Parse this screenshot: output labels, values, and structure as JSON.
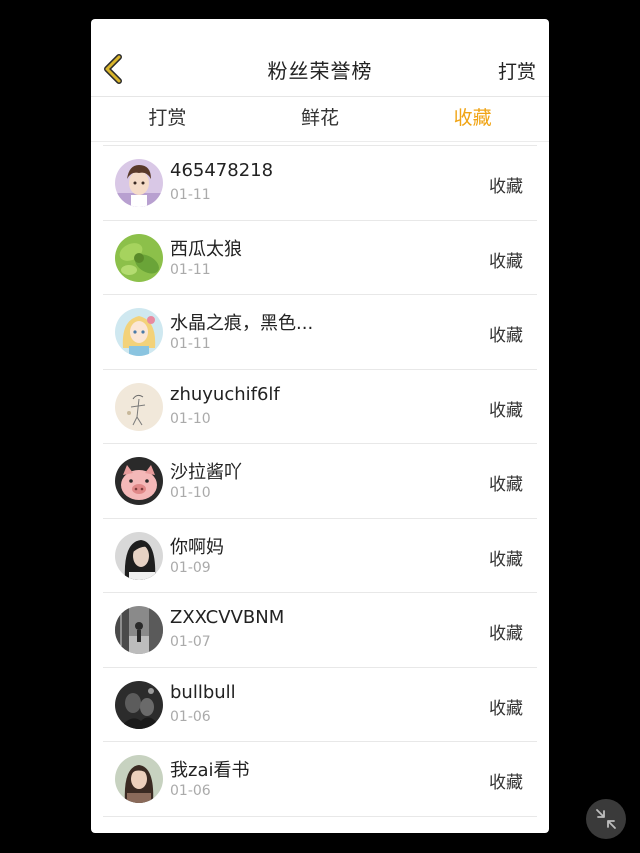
{
  "header": {
    "title": "粉丝荣誉榜",
    "reward_link": "打赏"
  },
  "tabs": [
    {
      "label": "打赏",
      "active": false
    },
    {
      "label": "鲜花",
      "active": false
    },
    {
      "label": "收藏",
      "active": true
    }
  ],
  "colors": {
    "accent": "#f0a415",
    "back_arrow": "#c8a020"
  },
  "list": [
    {
      "name": "465478218",
      "date": "01-11",
      "action": "收藏",
      "avatar": "anime-boy-avatar"
    },
    {
      "name": "西瓜太狼",
      "date": "01-11",
      "action": "收藏",
      "avatar": "green-leaf-avatar"
    },
    {
      "name": "水晶之痕，黑色...",
      "date": "01-11",
      "action": "收藏",
      "avatar": "anime-girl-avatar"
    },
    {
      "name": "zhuyuchif6lf",
      "date": "01-10",
      "action": "收藏",
      "avatar": "sketch-avatar"
    },
    {
      "name": "沙拉酱吖",
      "date": "01-10",
      "action": "收藏",
      "avatar": "pig-avatar"
    },
    {
      "name": "你啊妈",
      "date": "01-09",
      "action": "收藏",
      "avatar": "woman-portrait-avatar"
    },
    {
      "name": "ZXXCVVBNM",
      "date": "01-07",
      "action": "收藏",
      "avatar": "bw-street-avatar"
    },
    {
      "name": "bullbull",
      "date": "01-06",
      "action": "收藏",
      "avatar": "dark-photo-avatar"
    },
    {
      "name": "我zai看书",
      "date": "01-06",
      "action": "收藏",
      "avatar": "girl-photo-avatar"
    }
  ]
}
